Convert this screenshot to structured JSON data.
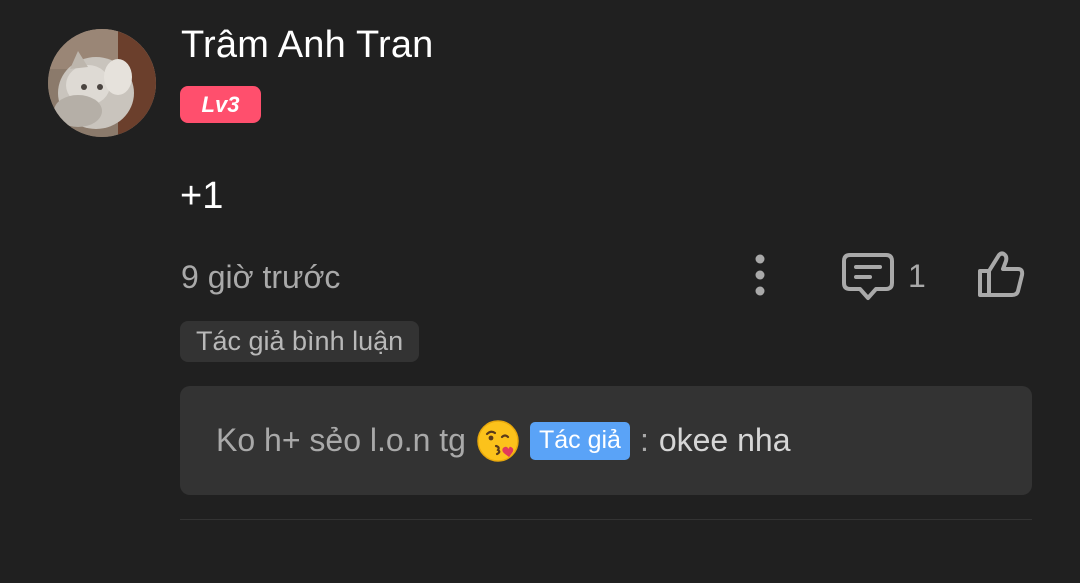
{
  "comment": {
    "username": "Trâm Anh Tran",
    "level": "Lv3",
    "text": "+1",
    "time": "9 giờ trước",
    "reply_count": "1",
    "author_commented_tag": "Tác giả bình luận"
  },
  "reply_preview": {
    "quoted_text": "Ko h+ sẻo l.o.n tg",
    "emoji": "kissing-face-emoji",
    "author_badge": "Tác giả",
    "separator": ":",
    "author_reply": "okee nha"
  },
  "colors": {
    "background": "#202020",
    "level_badge": "#ff4f6d",
    "author_badge": "#5aa3f7",
    "panel": "#333333",
    "muted_text": "#a9a9a9"
  },
  "icons": {
    "more": "more-vertical-icon",
    "reply": "comment-icon",
    "like": "thumbs-up-icon"
  }
}
